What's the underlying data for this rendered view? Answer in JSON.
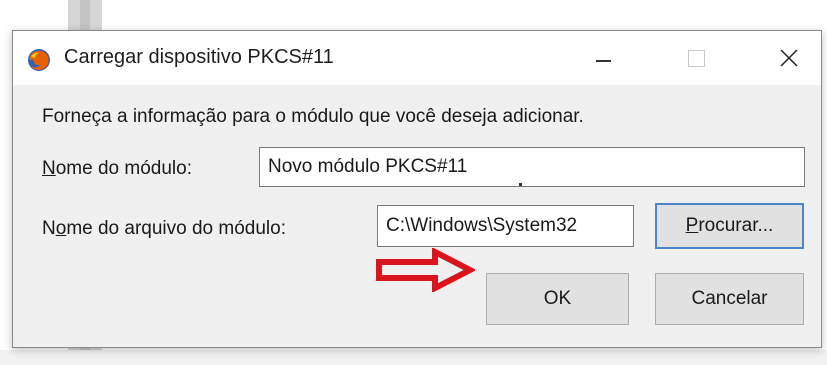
{
  "window": {
    "title": "Carregar dispositivo PKCS#11",
    "icon": "firefox-icon",
    "controls": {
      "minimize": "minimize-icon",
      "maximize": "maximize-icon",
      "close": "close-icon"
    }
  },
  "dialog": {
    "instruction": "Forneça a informação para o módulo que você deseja adicionar.",
    "module_name": {
      "label_mnemonic": "N",
      "label_rest": "ome do módulo:",
      "value": "Novo módulo PKCS#11"
    },
    "module_file": {
      "label_pre": "N",
      "label_mnemonic": "o",
      "label_rest": "me do arquivo do módulo:",
      "value": "C:\\Windows\\System32"
    },
    "browse_button": {
      "mnemonic": "P",
      "rest": "rocurar..."
    },
    "ok_button": "OK",
    "cancel_button": "Cancelar"
  },
  "annotation": {
    "icon": "red-arrow-icon",
    "color": "#d9141c"
  },
  "colors": {
    "default_button_border": "#4a86c8",
    "dialog_bg": "#f0f0f0",
    "titlebar_bg": "#ffffff"
  }
}
